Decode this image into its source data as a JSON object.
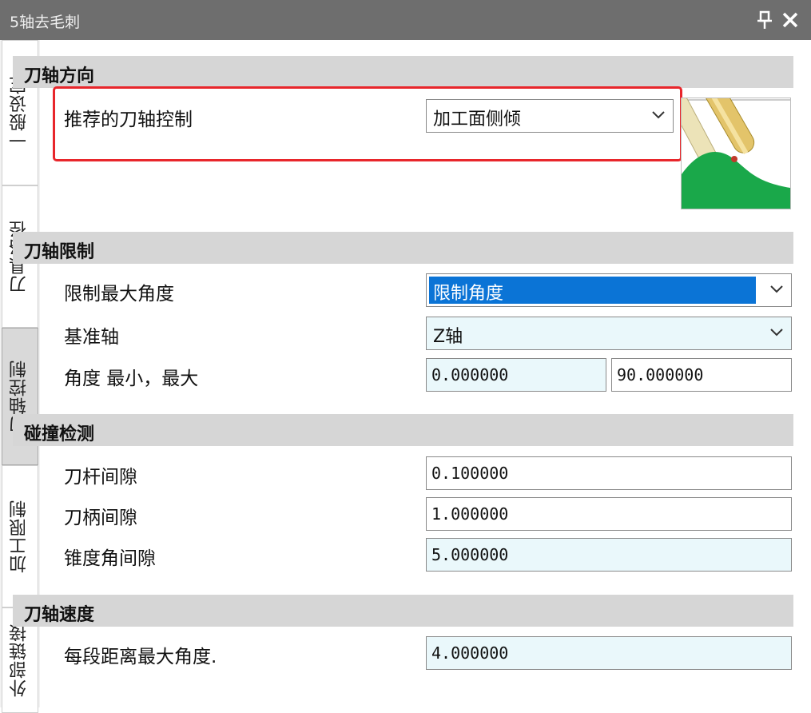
{
  "window": {
    "title": "5轴去毛刺",
    "pin_icon": "pin-icon",
    "close_icon": "close-icon"
  },
  "sidebar": {
    "tabs": [
      {
        "label": "一般设定",
        "active": false
      },
      {
        "label": "刀具路径",
        "active": false
      },
      {
        "label": "刀轴控制",
        "active": true
      },
      {
        "label": "加工限制",
        "active": false
      },
      {
        "label": "外部链接",
        "active": false
      }
    ]
  },
  "sections": {
    "tool_axis_direction": {
      "header": "刀轴方向",
      "recommended_label": "推荐的刀轴控制",
      "recommended_value": "加工面侧倾"
    },
    "tool_axis_limit": {
      "header": "刀轴限制",
      "max_angle_label": "限制最大角度",
      "max_angle_value": "限制角度",
      "ref_axis_label": "基准轴",
      "ref_axis_value": "Z轴",
      "angle_label": "角度  最小，最大",
      "angle_min": "0.000000",
      "angle_max": "90.000000"
    },
    "collision": {
      "header": "碰撞检测",
      "shank_label": "刀杆间隙",
      "shank_value": "0.100000",
      "holder_label": "刀柄间隙",
      "holder_value": "1.000000",
      "taper_label": "锥度角间隙",
      "taper_value": "5.000000"
    },
    "tool_axis_speed": {
      "header": "刀轴速度",
      "max_angle_label": "每段距离最大角度.",
      "max_angle_value": "4.000000"
    }
  },
  "colors": {
    "highlight": "#e8262b",
    "selection": "#0b74d6",
    "field_tint": "#eaf8fb",
    "header_bg": "#d6d6d6",
    "titlebar": "#6e6e6e"
  }
}
